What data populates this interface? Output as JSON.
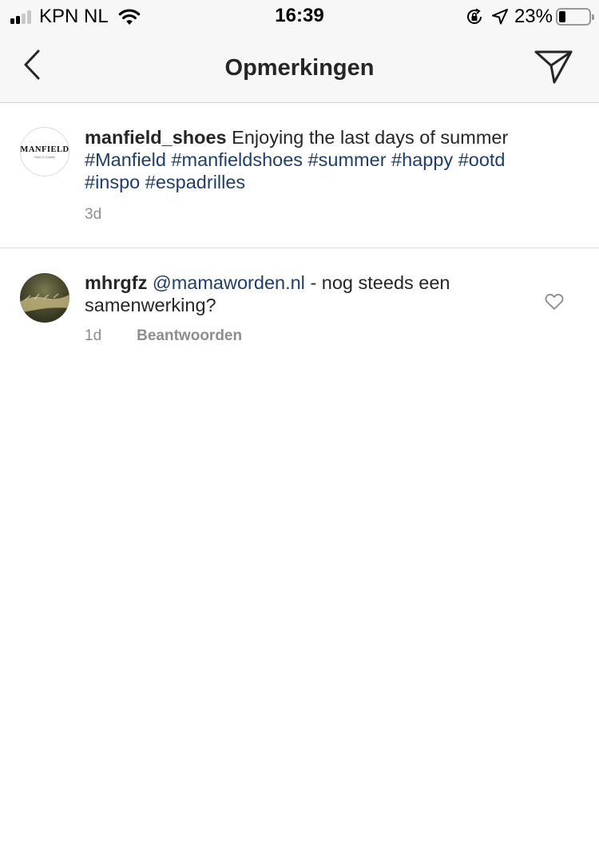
{
  "status_bar": {
    "carrier": "KPN NL",
    "time": "16:39",
    "battery_percent": "23%",
    "battery_level": 0.23,
    "signal_bars": 2,
    "icons": [
      "signal-icon",
      "wifi-icon",
      "orientation-lock-icon",
      "location-icon",
      "battery-icon"
    ]
  },
  "nav": {
    "title": "Opmerkingen",
    "back_icon": "chevron-left-icon",
    "share_icon": "paper-plane-icon"
  },
  "caption": {
    "username": "manfield_shoes",
    "text": "Enjoying the last days of summer",
    "hashtags": [
      "#Manfield",
      "#manfieldshoes",
      "#summer",
      "#happy",
      "#ootd",
      "#inspo",
      "#espadrilles"
    ],
    "time": "3d",
    "avatar_label": "MANFIELD",
    "avatar_tagline": "Style & Quality"
  },
  "comments": [
    {
      "username": "mhrgfz",
      "mention": "@mamaworden.nl",
      "text": "- nog steeds een samenwerking?",
      "time": "1d",
      "reply_label": "Beantwoorden",
      "like_icon": "heart-outline-icon"
    }
  ],
  "colors": {
    "link": "#1e3f6d",
    "muted": "#8e8e8e",
    "text": "#262626",
    "bar_background": "#f7f7f7"
  }
}
